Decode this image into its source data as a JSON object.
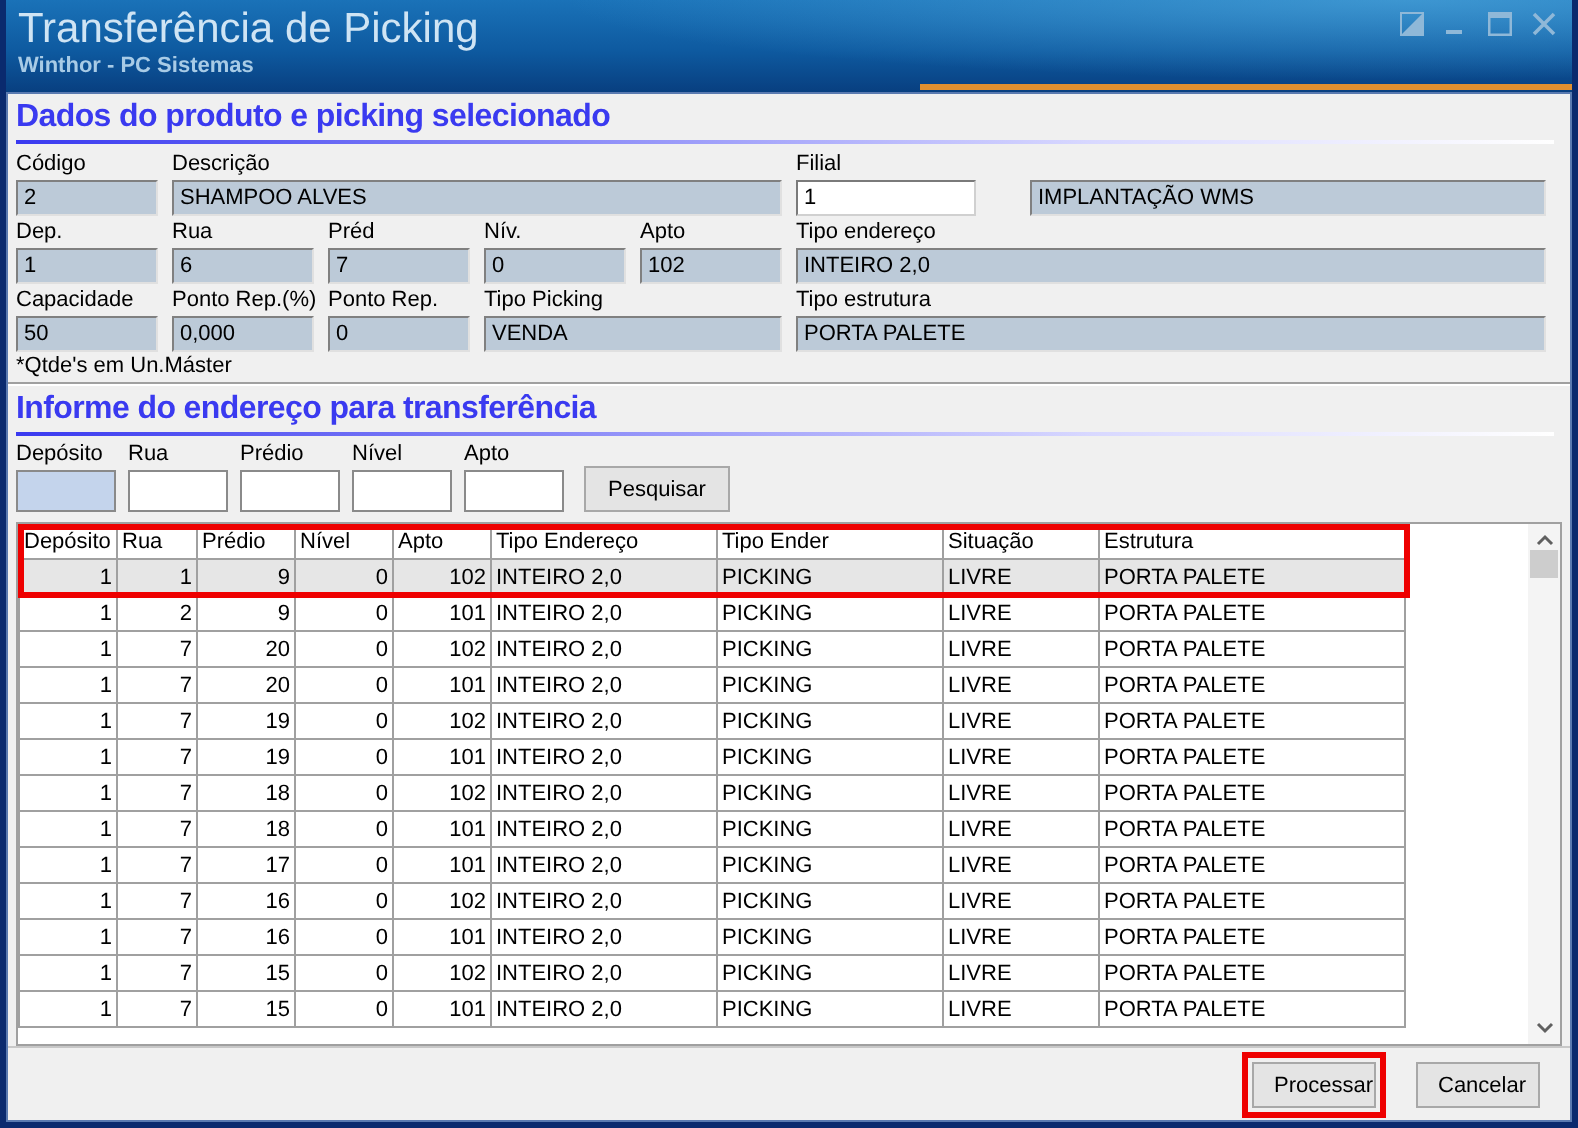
{
  "window": {
    "title": "Transferência de Picking",
    "subtitle": "Winthor - PC Sistemas"
  },
  "product_section": {
    "heading": "Dados do produto e picking selecionado",
    "fields": [
      {
        "label": "Código",
        "value": "2",
        "editable": false
      },
      {
        "label": "Descrição",
        "value": "SHAMPOO ALVES",
        "editable": false
      },
      {
        "label": "Filial",
        "value": "1",
        "editable": true
      },
      {
        "value": "IMPLANTAÇÃO WMS",
        "editable": false
      },
      {
        "label": "Dep.",
        "value": "1",
        "editable": false
      },
      {
        "label": "Rua",
        "value": "6",
        "editable": false
      },
      {
        "label": "Préd",
        "value": "7",
        "editable": false
      },
      {
        "label": "Nív.",
        "value": "0",
        "editable": false
      },
      {
        "label": "Apto",
        "value": "102",
        "editable": false
      },
      {
        "label": "Tipo endereço",
        "value": "INTEIRO 2,0",
        "editable": false
      },
      {
        "label": "Capacidade",
        "value": "50",
        "editable": false
      },
      {
        "label": "Ponto Rep.(%)",
        "value": "0,000",
        "editable": false
      },
      {
        "label": "Ponto Rep.",
        "value": "0",
        "editable": false
      },
      {
        "label": "Tipo Picking",
        "value": "VENDA",
        "editable": false
      },
      {
        "label": "Tipo estrutura",
        "value": "PORTA PALETE",
        "editable": false
      }
    ],
    "note": "*Qtde's em Un.Máster"
  },
  "address_section": {
    "heading": "Informe do endereço para transferência",
    "fields": [
      {
        "label": "Depósito",
        "focused": true
      },
      {
        "label": "Rua",
        "focused": false
      },
      {
        "label": "Prédio",
        "focused": false
      },
      {
        "label": "Nível",
        "focused": false
      },
      {
        "label": "Apto",
        "focused": false
      }
    ],
    "search_button": "Pesquisar"
  },
  "table": {
    "columns": [
      "Depósito",
      "Rua",
      "Prédio",
      "Nível",
      "Apto",
      "Tipo Endereço",
      "Tipo Ender",
      "Situação",
      "Estrutura"
    ],
    "rows": [
      {
        "cells": [
          "1",
          "1",
          "9",
          "0",
          "102",
          "INTEIRO 2,0",
          "PICKING",
          "LIVRE",
          "PORTA PALETE"
        ],
        "selected": true
      },
      {
        "cells": [
          "1",
          "2",
          "9",
          "0",
          "101",
          "INTEIRO 2,0",
          "PICKING",
          "LIVRE",
          "PORTA PALETE"
        ],
        "selected": false
      },
      {
        "cells": [
          "1",
          "7",
          "20",
          "0",
          "102",
          "INTEIRO 2,0",
          "PICKING",
          "LIVRE",
          "PORTA PALETE"
        ],
        "selected": false
      },
      {
        "cells": [
          "1",
          "7",
          "20",
          "0",
          "101",
          "INTEIRO 2,0",
          "PICKING",
          "LIVRE",
          "PORTA PALETE"
        ],
        "selected": false
      },
      {
        "cells": [
          "1",
          "7",
          "19",
          "0",
          "102",
          "INTEIRO 2,0",
          "PICKING",
          "LIVRE",
          "PORTA PALETE"
        ],
        "selected": false
      },
      {
        "cells": [
          "1",
          "7",
          "19",
          "0",
          "101",
          "INTEIRO 2,0",
          "PICKING",
          "LIVRE",
          "PORTA PALETE"
        ],
        "selected": false
      },
      {
        "cells": [
          "1",
          "7",
          "18",
          "0",
          "102",
          "INTEIRO 2,0",
          "PICKING",
          "LIVRE",
          "PORTA PALETE"
        ],
        "selected": false
      },
      {
        "cells": [
          "1",
          "7",
          "18",
          "0",
          "101",
          "INTEIRO 2,0",
          "PICKING",
          "LIVRE",
          "PORTA PALETE"
        ],
        "selected": false
      },
      {
        "cells": [
          "1",
          "7",
          "17",
          "0",
          "101",
          "INTEIRO 2,0",
          "PICKING",
          "LIVRE",
          "PORTA PALETE"
        ],
        "selected": false
      },
      {
        "cells": [
          "1",
          "7",
          "16",
          "0",
          "102",
          "INTEIRO 2,0",
          "PICKING",
          "LIVRE",
          "PORTA PALETE"
        ],
        "selected": false
      },
      {
        "cells": [
          "1",
          "7",
          "16",
          "0",
          "101",
          "INTEIRO 2,0",
          "PICKING",
          "LIVRE",
          "PORTA PALETE"
        ],
        "selected": false
      },
      {
        "cells": [
          "1",
          "7",
          "15",
          "0",
          "102",
          "INTEIRO 2,0",
          "PICKING",
          "LIVRE",
          "PORTA PALETE"
        ],
        "selected": false
      },
      {
        "cells": [
          "1",
          "7",
          "15",
          "0",
          "101",
          "INTEIRO 2,0",
          "PICKING",
          "LIVRE",
          "PORTA PALETE"
        ],
        "selected": false
      }
    ]
  },
  "buttons": [
    {
      "label": "Processar",
      "highlighted": true
    },
    {
      "label": "Cancelar",
      "highlighted": false
    }
  ]
}
